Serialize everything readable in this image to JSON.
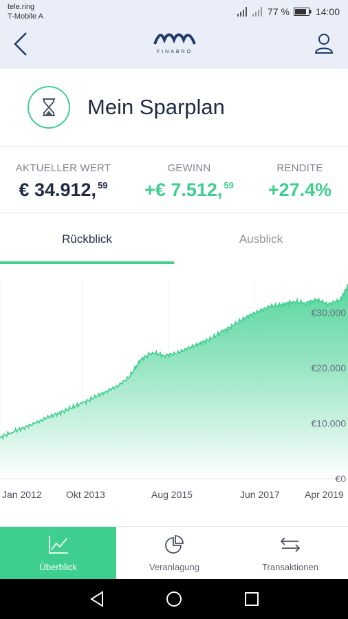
{
  "status_bar": {
    "carrier_line1": "tele.ring",
    "carrier_line2": "T-Mobile A",
    "battery": "77 %",
    "time": "14:00"
  },
  "header": {
    "logo_text": "FINABRO",
    "icons": {
      "back": "back-arrow-icon",
      "profile": "user-icon"
    }
  },
  "plan": {
    "title": "Mein Sparplan",
    "icon": "hourglass-icon"
  },
  "stats": [
    {
      "label": "AKTUELLER WERT",
      "value": "€ 34.912,",
      "cents": "59"
    },
    {
      "label": "GEWINN",
      "value": "+€ 7.512,",
      "cents": "59"
    },
    {
      "label": "RENDITE",
      "value": "+27.4%",
      "cents": ""
    }
  ],
  "tabs": [
    {
      "label": "Rückblick",
      "active": true
    },
    {
      "label": "Ausblick",
      "active": false
    }
  ],
  "chart_data": {
    "type": "area",
    "x": [
      "2012-01",
      "2012-04",
      "2012-07",
      "2012-10",
      "2013-01",
      "2013-04",
      "2013-07",
      "2013-10",
      "2014-01",
      "2014-04",
      "2014-07",
      "2014-10",
      "2015-01",
      "2015-04",
      "2015-07",
      "2015-10",
      "2016-01",
      "2016-04",
      "2016-07",
      "2016-10",
      "2017-01",
      "2017-04",
      "2017-07",
      "2017-10",
      "2018-01",
      "2018-04",
      "2018-07",
      "2018-10",
      "2019-01",
      "2019-04",
      "2019-06"
    ],
    "series": [
      {
        "values": [
          7400,
          8400,
          9200,
          10000,
          11000,
          11800,
          12700,
          13600,
          14600,
          15700,
          16700,
          18300,
          21500,
          22800,
          22200,
          22600,
          23500,
          24400,
          25300,
          26600,
          27800,
          29200,
          30200,
          31100,
          31400,
          32000,
          31700,
          32300,
          31500,
          32300,
          34900
        ]
      }
    ],
    "x_tick_labels": [
      "Jan 2012",
      "Okt 2013",
      "Aug 2015",
      "Jun 2017",
      "Apr 2019"
    ],
    "y_tick_labels": [
      "€0",
      "€10.000",
      "€20.000",
      "€30.000"
    ],
    "ylim": [
      0,
      36000
    ],
    "grid": true,
    "colors": {
      "line": "#3ecf8e",
      "fill_top": "#3ecf8e",
      "fill_bottom": "#ffffff"
    }
  },
  "bottom_nav": [
    {
      "label": "Überblick",
      "icon": "line-chart-icon",
      "active": true
    },
    {
      "label": "Veranlagung",
      "icon": "pie-chart-icon",
      "active": false
    },
    {
      "label": "Transaktionen",
      "icon": "transfer-arrows-icon",
      "active": false
    }
  ],
  "system_nav": {
    "back": "back-triangle-icon",
    "home": "home-circle-icon",
    "recents": "recents-square-icon"
  },
  "colors": {
    "accent": "#3ecf8e",
    "header_bg": "#e9eef8",
    "text_dark": "#1f2a44",
    "text_muted": "#7f8595"
  }
}
